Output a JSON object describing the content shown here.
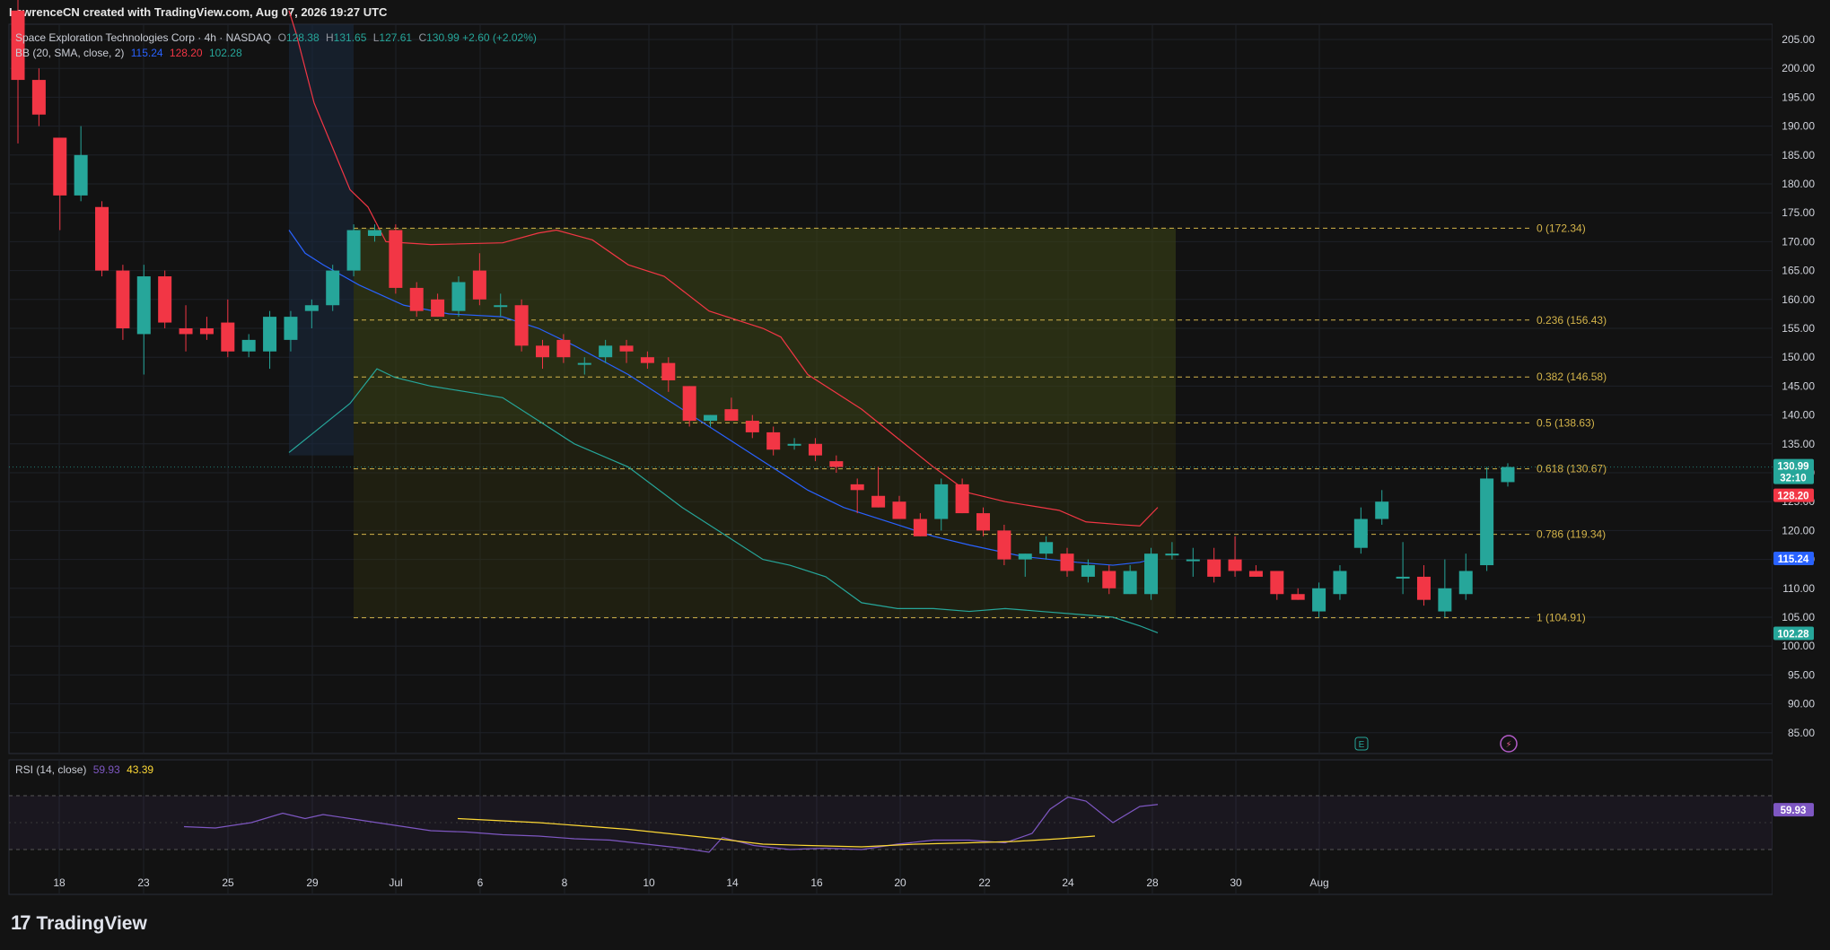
{
  "header": {
    "attribution": "LawrenceCN created with TradingView.com, Aug 07, 2026 19:27 UTC"
  },
  "legend": {
    "symbol": "Space Exploration Technologies Corp · 4h · NASDAQ",
    "o_key": "O",
    "o": "128.38",
    "h_key": "H",
    "h": "131.65",
    "l_key": "L",
    "l": "127.61",
    "c_key": "C",
    "c": "130.99",
    "change": "+2.60 (+2.02%)",
    "bb_label": "BB (20, SMA, close, 2)",
    "bb_basis": "115.24",
    "bb_upper": "128.20",
    "bb_lower": "102.28",
    "rsi_label": "RSI (14, close)",
    "rsi_value": "59.93",
    "rsi_ma": "43.39"
  },
  "colors": {
    "up": "#26a69a",
    "down": "#f23645",
    "bb_upper": "#f23645",
    "bb_basis": "#2962ff",
    "bb_lower": "#26a69a",
    "fib": "#d4b44a",
    "rsi": "#7e57c2",
    "rsi_ma": "#fdd835"
  },
  "price_axis_labels": [
    "205.00",
    "200.00",
    "195.00",
    "190.00",
    "185.00",
    "180.00",
    "175.00",
    "170.00",
    "165.00",
    "160.00",
    "155.00",
    "150.00",
    "145.00",
    "140.00",
    "135.00",
    "130.00",
    "125.00",
    "120.00",
    "115.00",
    "110.00",
    "105.00",
    "100.00",
    "95.00",
    "90.00",
    "85.00"
  ],
  "price_tags": {
    "last": "130.99",
    "countdown": "32:10",
    "bb_upper": "128.20",
    "bb_basis": "115.24",
    "bb_lower": "102.28",
    "rsi": "59.93"
  },
  "time_axis_labels": [
    "18",
    "23",
    "25",
    "29",
    "Jul",
    "6",
    "8",
    "10",
    "14",
    "16",
    "20",
    "22",
    "24",
    "28",
    "30",
    "Aug"
  ],
  "event_markers": [
    "E",
    "⚡"
  ],
  "branding": {
    "logo_mark": "17",
    "logo_text": "TradingView"
  },
  "chart_data": {
    "type": "candlestick",
    "title": "Space Exploration Technologies Corp · 4h · NASDAQ",
    "ylim": [
      81,
      208
    ],
    "grid": true,
    "candles": [
      {
        "o": 210,
        "h": 214,
        "l": 187,
        "c": 198
      },
      {
        "o": 198,
        "h": 200,
        "l": 190,
        "c": 192
      },
      {
        "o": 188,
        "h": 188,
        "l": 172,
        "c": 178
      },
      {
        "o": 178,
        "h": 190,
        "l": 177,
        "c": 185
      },
      {
        "o": 176,
        "h": 177,
        "l": 164,
        "c": 165
      },
      {
        "o": 165,
        "h": 166,
        "l": 153,
        "c": 155
      },
      {
        "o": 154,
        "h": 166,
        "l": 147,
        "c": 164
      },
      {
        "o": 164,
        "h": 165,
        "l": 155,
        "c": 156
      },
      {
        "o": 155,
        "h": 159,
        "l": 151,
        "c": 154
      },
      {
        "o": 155,
        "h": 157,
        "l": 153,
        "c": 154
      },
      {
        "o": 156,
        "h": 160,
        "l": 150,
        "c": 151
      },
      {
        "o": 151,
        "h": 154,
        "l": 150,
        "c": 153
      },
      {
        "o": 151,
        "h": 158,
        "l": 148,
        "c": 157
      },
      {
        "o": 153,
        "h": 158,
        "l": 151,
        "c": 157
      },
      {
        "o": 158,
        "h": 160,
        "l": 155,
        "c": 159
      },
      {
        "o": 159,
        "h": 166,
        "l": 158,
        "c": 165
      },
      {
        "o": 165,
        "h": 173,
        "l": 164,
        "c": 172
      },
      {
        "o": 171,
        "h": 173,
        "l": 170,
        "c": 172
      },
      {
        "o": 172,
        "h": 173,
        "l": 161,
        "c": 162
      },
      {
        "o": 162,
        "h": 163,
        "l": 157,
        "c": 158
      },
      {
        "o": 160,
        "h": 161,
        "l": 157,
        "c": 157
      },
      {
        "o": 158,
        "h": 164,
        "l": 157,
        "c": 163
      },
      {
        "o": 165,
        "h": 168,
        "l": 159,
        "c": 160
      },
      {
        "o": 159,
        "h": 161,
        "l": 157,
        "c": 159
      },
      {
        "o": 159,
        "h": 160,
        "l": 151,
        "c": 152
      },
      {
        "o": 152,
        "h": 153,
        "l": 148,
        "c": 150
      },
      {
        "o": 153,
        "h": 154,
        "l": 149,
        "c": 150
      },
      {
        "o": 149,
        "h": 150,
        "l": 147,
        "c": 149
      },
      {
        "o": 150,
        "h": 153,
        "l": 149,
        "c": 152
      },
      {
        "o": 152,
        "h": 153,
        "l": 149,
        "c": 151
      },
      {
        "o": 150,
        "h": 151,
        "l": 148,
        "c": 149
      },
      {
        "o": 149,
        "h": 150,
        "l": 144,
        "c": 146
      },
      {
        "o": 145,
        "h": 145,
        "l": 138,
        "c": 139
      },
      {
        "o": 139,
        "h": 140,
        "l": 138,
        "c": 140
      },
      {
        "o": 141,
        "h": 143,
        "l": 139,
        "c": 139
      },
      {
        "o": 139,
        "h": 140,
        "l": 136,
        "c": 137
      },
      {
        "o": 137,
        "h": 138,
        "l": 133,
        "c": 134
      },
      {
        "o": 135,
        "h": 136,
        "l": 134,
        "c": 135
      },
      {
        "o": 135,
        "h": 136,
        "l": 132,
        "c": 133
      },
      {
        "o": 132,
        "h": 133,
        "l": 130,
        "c": 131
      },
      {
        "o": 128,
        "h": 129,
        "l": 123,
        "c": 127
      },
      {
        "o": 126,
        "h": 131,
        "l": 124,
        "c": 124
      },
      {
        "o": 125,
        "h": 126,
        "l": 122,
        "c": 122
      },
      {
        "o": 122,
        "h": 123,
        "l": 119,
        "c": 119
      },
      {
        "o": 122,
        "h": 129,
        "l": 120,
        "c": 128
      },
      {
        "o": 128,
        "h": 129,
        "l": 123,
        "c": 123
      },
      {
        "o": 123,
        "h": 124,
        "l": 119,
        "c": 120
      },
      {
        "o": 120,
        "h": 121,
        "l": 114,
        "c": 115
      },
      {
        "o": 115,
        "h": 116,
        "l": 112,
        "c": 116
      },
      {
        "o": 116,
        "h": 119,
        "l": 115,
        "c": 118
      },
      {
        "o": 116,
        "h": 117,
        "l": 112,
        "c": 113
      },
      {
        "o": 112,
        "h": 115,
        "l": 111,
        "c": 114
      },
      {
        "o": 113,
        "h": 114,
        "l": 109,
        "c": 110
      },
      {
        "o": 109,
        "h": 114,
        "l": 109,
        "c": 113
      },
      {
        "o": 109,
        "h": 117,
        "l": 108,
        "c": 116
      },
      {
        "o": 116,
        "h": 118,
        "l": 115,
        "c": 116
      },
      {
        "o": 115,
        "h": 117,
        "l": 112,
        "c": 115
      },
      {
        "o": 115,
        "h": 117,
        "l": 111,
        "c": 112
      },
      {
        "o": 115,
        "h": 119,
        "l": 112,
        "c": 113
      },
      {
        "o": 113,
        "h": 114,
        "l": 112,
        "c": 112
      },
      {
        "o": 113,
        "h": 113,
        "l": 108,
        "c": 109
      },
      {
        "o": 109,
        "h": 110,
        "l": 108,
        "c": 108
      },
      {
        "o": 106,
        "h": 111,
        "l": 105,
        "c": 110
      },
      {
        "o": 109,
        "h": 114,
        "l": 108,
        "c": 113
      },
      {
        "o": 117,
        "h": 124,
        "l": 116,
        "c": 122
      },
      {
        "o": 122,
        "h": 127,
        "l": 121,
        "c": 125
      },
      {
        "o": 112,
        "h": 118,
        "l": 109,
        "c": 112
      },
      {
        "o": 112,
        "h": 114,
        "l": 107,
        "c": 108
      },
      {
        "o": 106,
        "h": 115,
        "l": 105,
        "c": 110
      },
      {
        "o": 109,
        "h": 116,
        "l": 108,
        "c": 113
      },
      {
        "o": 114,
        "h": 131,
        "l": 113,
        "c": 129
      },
      {
        "o": 128.38,
        "h": 131.65,
        "l": 127.61,
        "c": 130.99
      }
    ],
    "bb_upper": [
      [
        322,
        210
      ],
      [
        330,
        206
      ],
      [
        350,
        194
      ],
      [
        390,
        179
      ],
      [
        410,
        176
      ],
      [
        430,
        170
      ],
      [
        480,
        169.5
      ],
      [
        560,
        169.8
      ],
      [
        600,
        171.5
      ],
      [
        620,
        172
      ],
      [
        660,
        170.3
      ],
      [
        700,
        166
      ],
      [
        740,
        164
      ],
      [
        790,
        158
      ],
      [
        850,
        155
      ],
      [
        870,
        153.5
      ],
      [
        900,
        147
      ],
      [
        960,
        141
      ],
      [
        1000,
        136
      ],
      [
        1040,
        131
      ],
      [
        1080,
        126.5
      ],
      [
        1120,
        125
      ],
      [
        1180,
        123.5
      ],
      [
        1210,
        121.5
      ],
      [
        1250,
        121
      ],
      [
        1270,
        120.8
      ],
      [
        1290,
        124
      ]
    ],
    "bb_basis": [
      [
        322,
        172
      ],
      [
        340,
        168
      ],
      [
        360,
        166
      ],
      [
        400,
        162.5
      ],
      [
        450,
        159
      ],
      [
        500,
        157.5
      ],
      [
        560,
        157
      ],
      [
        600,
        155
      ],
      [
        640,
        152
      ],
      [
        700,
        147
      ],
      [
        760,
        141
      ],
      [
        800,
        137
      ],
      [
        850,
        132
      ],
      [
        900,
        127
      ],
      [
        940,
        124
      ],
      [
        1000,
        121
      ],
      [
        1040,
        119
      ],
      [
        1080,
        117.5
      ],
      [
        1140,
        115.5
      ],
      [
        1200,
        114.5
      ],
      [
        1240,
        114
      ],
      [
        1270,
        114.5
      ],
      [
        1290,
        115.3
      ]
    ],
    "bb_lower": [
      [
        322,
        133.5
      ],
      [
        330,
        134.5
      ],
      [
        350,
        137
      ],
      [
        390,
        142
      ],
      [
        420,
        148
      ],
      [
        440,
        146.5
      ],
      [
        480,
        145
      ],
      [
        520,
        144
      ],
      [
        560,
        143
      ],
      [
        600,
        139
      ],
      [
        640,
        135
      ],
      [
        700,
        131
      ],
      [
        760,
        124
      ],
      [
        800,
        120
      ],
      [
        850,
        115
      ],
      [
        880,
        114
      ],
      [
        920,
        112
      ],
      [
        960,
        107.5
      ],
      [
        1000,
        106.5
      ],
      [
        1040,
        106.5
      ],
      [
        1080,
        106
      ],
      [
        1120,
        106.5
      ],
      [
        1160,
        106
      ],
      [
        1200,
        105.5
      ],
      [
        1240,
        105
      ],
      [
        1270,
        103.5
      ],
      [
        1290,
        102.3
      ]
    ],
    "fibonacci": [
      {
        "ratio": "0",
        "price": 172.34,
        "label": "0 (172.34)"
      },
      {
        "ratio": "0.236",
        "price": 156.43,
        "label": "0.236 (156.43)"
      },
      {
        "ratio": "0.382",
        "price": 146.58,
        "label": "0.382 (146.58)"
      },
      {
        "ratio": "0.5",
        "price": 138.63,
        "label": "0.5 (138.63)"
      },
      {
        "ratio": "0.618",
        "price": 130.67,
        "label": "0.618 (130.67)"
      },
      {
        "ratio": "0.786",
        "price": 119.34,
        "label": "0.786 (119.34)"
      },
      {
        "ratio": "1",
        "price": 104.91,
        "label": "1 (104.91)"
      }
    ],
    "rsi": {
      "ylim": [
        20,
        90
      ],
      "upper_band": 70,
      "lower_band": 30,
      "rsi_line": [
        [
          205,
          47
        ],
        [
          240,
          46
        ],
        [
          280,
          50
        ],
        [
          315,
          57
        ],
        [
          340,
          53
        ],
        [
          360,
          56
        ],
        [
          400,
          52
        ],
        [
          440,
          48
        ],
        [
          480,
          44
        ],
        [
          520,
          43
        ],
        [
          560,
          41
        ],
        [
          600,
          40
        ],
        [
          640,
          38
        ],
        [
          680,
          37
        ],
        [
          720,
          34
        ],
        [
          760,
          31
        ],
        [
          790,
          28
        ],
        [
          805,
          39
        ],
        [
          840,
          33
        ],
        [
          880,
          30
        ],
        [
          920,
          31
        ],
        [
          960,
          30
        ],
        [
          1000,
          34
        ],
        [
          1040,
          37
        ],
        [
          1080,
          37
        ],
        [
          1120,
          35
        ],
        [
          1150,
          42
        ],
        [
          1170,
          60
        ],
        [
          1190,
          69
        ],
        [
          1210,
          66
        ],
        [
          1240,
          50
        ],
        [
          1270,
          62
        ],
        [
          1290,
          63.5
        ]
      ],
      "rsi_ma": [
        [
          510,
          53
        ],
        [
          540,
          52
        ],
        [
          600,
          50
        ],
        [
          700,
          45
        ],
        [
          800,
          38
        ],
        [
          850,
          34
        ],
        [
          900,
          33
        ],
        [
          960,
          32
        ],
        [
          1020,
          34
        ],
        [
          1080,
          35
        ],
        [
          1130,
          36
        ],
        [
          1180,
          38
        ],
        [
          1220,
          40
        ]
      ]
    }
  }
}
